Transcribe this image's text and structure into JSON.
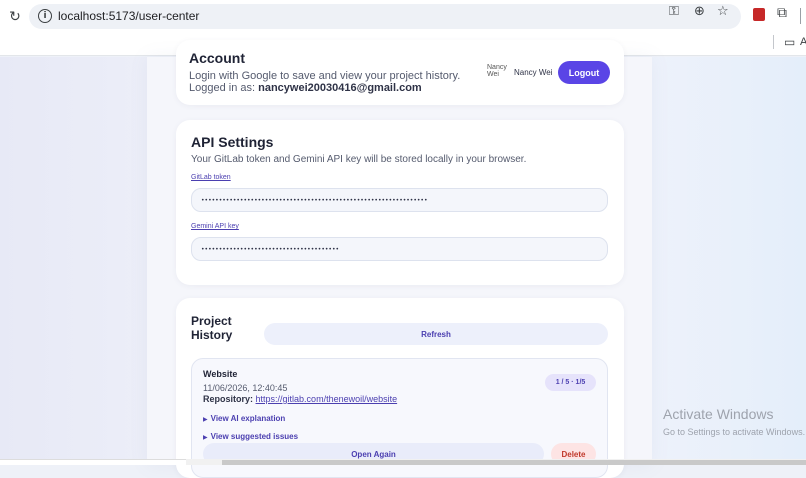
{
  "browser": {
    "url": "localhost:5173/user-center",
    "icons": {
      "reload": "reload-icon",
      "info": "info-icon",
      "password": "key-icon",
      "zoom": "zoom-icon",
      "bookmark": "star-icon",
      "extension": "extension-icon",
      "puzzle": "puzzle-icon",
      "folder": "folder-icon"
    },
    "bookmark_bar_text": "A"
  },
  "account": {
    "title": "Account",
    "description": "Login with Google to save and view your project history.",
    "logged_in_label": "Logged in as:",
    "email": "nancywei20030416@gmail.com",
    "avatar_alt": "Nancy Wei",
    "user_name": "Nancy Wei",
    "logout_label": "Logout"
  },
  "api_settings": {
    "title": "API Settings",
    "subtitle": "Your GitLab token and Gemini API key will be stored locally in your browser.",
    "gitlab_label": "GitLab token",
    "gitlab_value": "••••••••••••••••••••••••••••••••••••••••••••••••••••••••••••••••",
    "gemini_label": "Gemini API key",
    "gemini_value": "•••••••••••••••••••••••••••••••••••••••"
  },
  "project_history": {
    "title": "Project History",
    "refresh_label": "Refresh",
    "entries": [
      {
        "name": "Website",
        "date": "11/06/2026, 12:40:45",
        "repo_label": "Repository:",
        "repo_url": "https://gitlab.com/thenewoil/website",
        "score": "1 / 5 · 1/5",
        "ai_toggle": "View AI explanation",
        "issues_toggle": "View suggested issues",
        "open_label": "Open Again",
        "delete_label": "Delete"
      }
    ]
  },
  "watermark": {
    "title": "Activate Windows",
    "subtitle": "Go to Settings to activate Windows."
  },
  "colors": {
    "accent": "#5a45e6",
    "accent_text": "#4b3fb0",
    "danger": "#c0392b",
    "danger_bg": "#fde4e4"
  }
}
